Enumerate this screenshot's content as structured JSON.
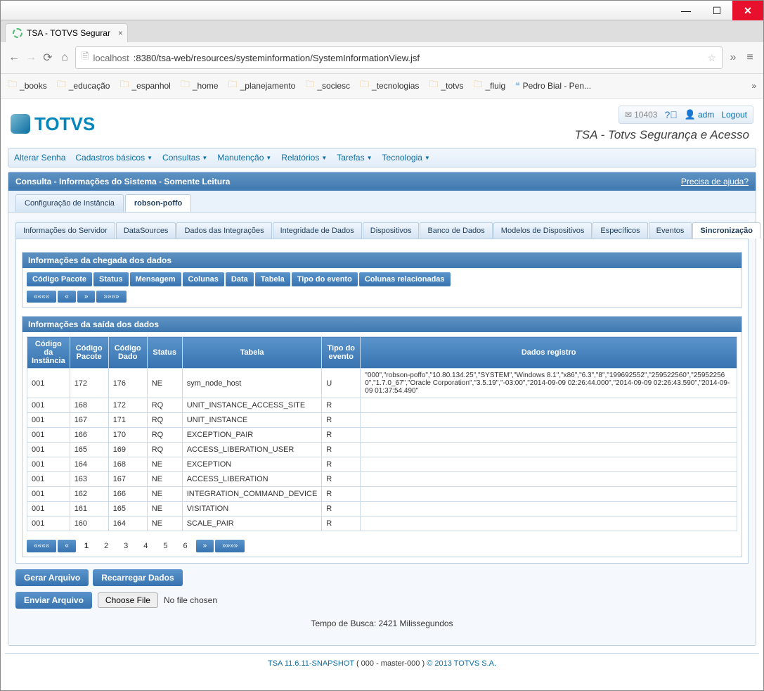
{
  "window": {
    "tab_title": "TSA - TOTVS Segurar",
    "url_host": "localhost",
    "url_port_path": ":8380/tsa-web/resources/systeminformation/SystemInformationView.jsf"
  },
  "bookmarks": [
    "_books",
    "_educação",
    "_espanhol",
    "_home",
    "_planejamento",
    "_sociesc",
    "_tecnologias",
    "_totvs",
    "_fluig"
  ],
  "bookmark_link": "Pedro Bial - Pen...",
  "header_actions": {
    "mail_count": "10403",
    "user": "adm",
    "logout": "Logout"
  },
  "app_subtitle": "TSA - Totvs Segurança e Acesso",
  "menu": [
    "Alterar Senha",
    "Cadastros básicos",
    "Consultas",
    "Manutenção",
    "Relatórios",
    "Tarefas",
    "Tecnologia"
  ],
  "menu_has_dropdown": [
    false,
    true,
    true,
    true,
    true,
    true,
    true
  ],
  "panel_title": "Consulta - Informações do Sistema - Somente Leitura",
  "help_link": "Precisa de ajuda?",
  "tabs": [
    "Configuração de Instância",
    "robson-poffo"
  ],
  "subtabs": [
    "Informações do Servidor",
    "DataSources",
    "Dados das Integrações",
    "Integridade de Dados",
    "Dispositivos",
    "Banco de Dados",
    "Modelos de Dispositivos",
    "Específicos",
    "Eventos",
    "Sincronização"
  ],
  "panel1": {
    "title": "Informações da chegada dos dados",
    "headers": [
      "Código Pacote",
      "Status",
      "Mensagem",
      "Colunas",
      "Data",
      "Tabela",
      "Tipo do evento",
      "Colunas relacionadas"
    ]
  },
  "panel2": {
    "title": "Informações da saída dos dados",
    "headers": [
      "Código da Instância",
      "Código Pacote",
      "Código Dado",
      "Status",
      "Tabela",
      "Tipo do evento",
      "Dados registro"
    ],
    "rows": [
      [
        "001",
        "172",
        "176",
        "NE",
        "sym_node_host",
        "U",
        "\"000\",\"robson-poffo\",\"10.80.134.25\",\"SYSTEM\",\"Windows 8.1\",\"x86\",\"6.3\",\"8\",\"199692552\",\"259522560\",\"259522560\",\"1.7.0_67\",\"Oracle Corporation\",\"3.5.19\",\"-03:00\",\"2014-09-09 02:26:44.000\",\"2014-09-09 02:26:43.590\",\"2014-09-09 01:37:54.490\""
      ],
      [
        "001",
        "168",
        "172",
        "RQ",
        "UNIT_INSTANCE_ACCESS_SITE",
        "R",
        ""
      ],
      [
        "001",
        "167",
        "171",
        "RQ",
        "UNIT_INSTANCE",
        "R",
        ""
      ],
      [
        "001",
        "166",
        "170",
        "RQ",
        "EXCEPTION_PAIR",
        "R",
        ""
      ],
      [
        "001",
        "165",
        "169",
        "RQ",
        "ACCESS_LIBERATION_USER",
        "R",
        ""
      ],
      [
        "001",
        "164",
        "168",
        "NE",
        "EXCEPTION",
        "R",
        ""
      ],
      [
        "001",
        "163",
        "167",
        "NE",
        "ACCESS_LIBERATION",
        "R",
        ""
      ],
      [
        "001",
        "162",
        "166",
        "NE",
        "INTEGRATION_COMMAND_DEVICE",
        "R",
        ""
      ],
      [
        "001",
        "161",
        "165",
        "NE",
        "VISITATION",
        "R",
        ""
      ],
      [
        "001",
        "160",
        "164",
        "NE",
        "SCALE_PAIR",
        "R",
        ""
      ]
    ]
  },
  "pager_nums": [
    "1",
    "2",
    "3",
    "4",
    "5",
    "6"
  ],
  "buttons": {
    "gerar": "Gerar Arquivo",
    "recarregar": "Recarregar Dados",
    "enviar": "Enviar Arquivo",
    "choose_file": "Choose File",
    "no_file": "No file chosen"
  },
  "timing": "Tempo de Busca: 2421 Milissegundos",
  "footer": {
    "version": "TSA 11.6.11-SNAPSHOT",
    "instance": "( 000 - master-000 )",
    "copyright": "© 2013 TOTVS S.A."
  },
  "logo_text": "TOTVS"
}
